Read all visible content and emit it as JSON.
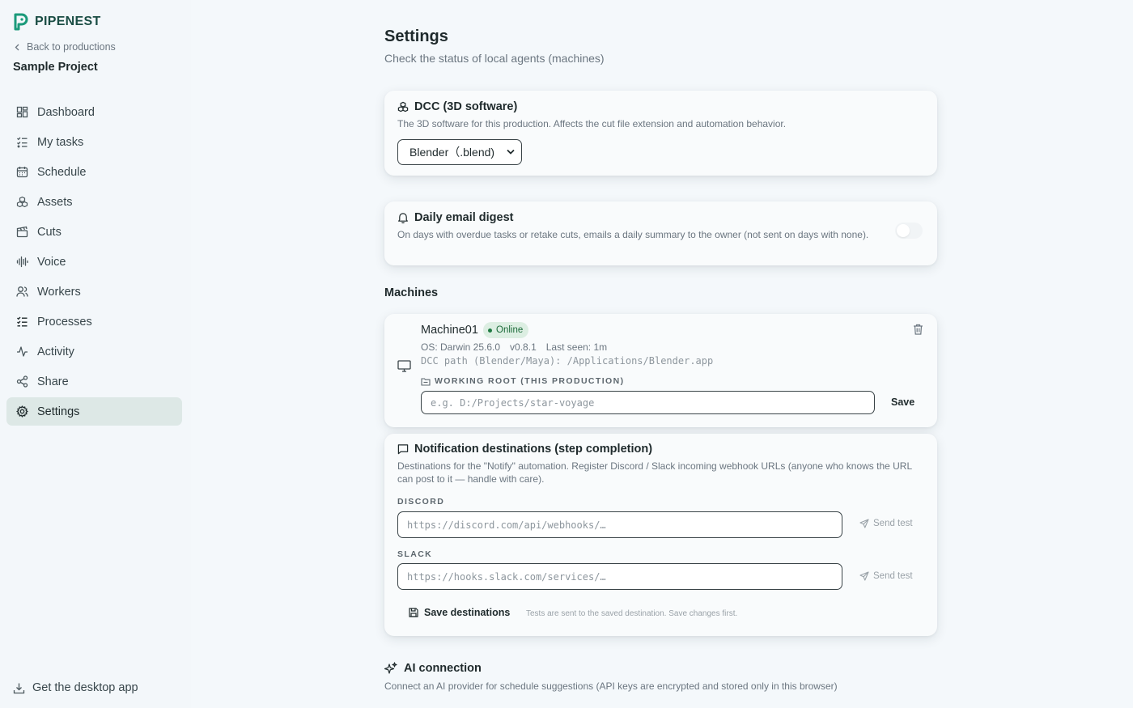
{
  "brand": {
    "name": "PIPENEST",
    "accent": "#1a9a7a"
  },
  "sidebar": {
    "back_label": "Back to productions",
    "project_name": "Sample Project",
    "items": [
      {
        "label": "Dashboard",
        "icon": "dashboard-icon"
      },
      {
        "label": "My tasks",
        "icon": "tasks-icon"
      },
      {
        "label": "Schedule",
        "icon": "calendar-icon"
      },
      {
        "label": "Assets",
        "icon": "assets-icon"
      },
      {
        "label": "Cuts",
        "icon": "clapperboard-icon"
      },
      {
        "label": "Voice",
        "icon": "waveform-icon"
      },
      {
        "label": "Workers",
        "icon": "users-icon"
      },
      {
        "label": "Processes",
        "icon": "checklist-icon"
      },
      {
        "label": "Activity",
        "icon": "activity-icon"
      },
      {
        "label": "Share",
        "icon": "share-icon"
      },
      {
        "label": "Settings",
        "icon": "gear-icon",
        "active": true
      }
    ],
    "desktop_app_label": "Get the desktop app"
  },
  "page": {
    "title": "Settings",
    "subtitle": "Check the status of local agents (machines)"
  },
  "dcc": {
    "title": "DCC (3D software)",
    "description": "The 3D software for this production. Affects the cut file extension and automation behavior.",
    "selected": "Blender（.blend)"
  },
  "digest": {
    "title": "Daily email digest",
    "description": "On days with overdue tasks or retake cuts, emails a daily summary to the owner (not sent on days with none).",
    "enabled": false
  },
  "machines": {
    "heading": "Machines",
    "items": [
      {
        "name": "Machine01",
        "status": "Online",
        "os": "OS: Darwin 25.6.0",
        "version": "v0.8.1",
        "last_seen": "Last seen: 1m",
        "dcc_path": "DCC path (Blender/Maya): /Applications/Blender.app",
        "working_root_label": "WORKING ROOT (THIS PRODUCTION)",
        "working_root_placeholder": "e.g. D:/Projects/star-voyage",
        "save_label": "Save"
      }
    ]
  },
  "notifications": {
    "title": "Notification destinations (step completion)",
    "description": "Destinations for the \"Notify\" automation. Register Discord / Slack incoming webhook URLs (anyone who knows the URL can post to it — handle with care).",
    "discord_label": "DISCORD",
    "discord_placeholder": "https://discord.com/api/webhooks/…",
    "slack_label": "SLACK",
    "slack_placeholder": "https://hooks.slack.com/services/…",
    "send_test_label": "Send test",
    "save_label": "Save destinations",
    "hint": "Tests are sent to the saved destination. Save changes first."
  },
  "ai": {
    "title": "AI connection",
    "description": "Connect an AI provider for schedule suggestions (API keys are encrypted and stored only in this browser)"
  }
}
